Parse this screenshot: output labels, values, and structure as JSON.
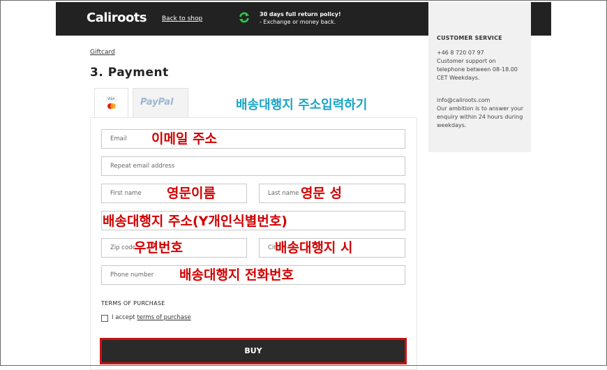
{
  "header": {
    "logo": "Caliroots",
    "back_link": "Back to shop",
    "policy_title": "30 days full return policy!",
    "policy_sub": "- Exchange or money back."
  },
  "breadcrumb": "Giftcard",
  "step_title": "3. Payment",
  "payment_tabs": {
    "paypal": "PayPal"
  },
  "overlay_top": "배송대행지 주소입력하기",
  "form": {
    "email_placeholder": "Email",
    "repeat_email_placeholder": "Repeat email address",
    "first_name_placeholder": "First name",
    "last_name_placeholder": "Last name",
    "zip_placeholder": "Zip code",
    "city_placeholder": "City",
    "phone_placeholder": "Phone number"
  },
  "annotations": {
    "email": "이메일 주소",
    "first_name": "영문이름",
    "last_name": "영문 성",
    "address": "배송대행지 주소(Y개인식별번호)",
    "zip": "우편번호",
    "city": "배송대행지 시",
    "phone": "배송대행지 전화번호"
  },
  "terms": {
    "title": "TERMS OF PURCHASE",
    "accept_prefix": "I accept ",
    "accept_link": "terms of purchase"
  },
  "buy_label": "BUY",
  "sidebar": {
    "title": "CUSTOMER SERVICE",
    "phone": "+46 8 720 07 97",
    "phone_desc": "Customer support on telephone between 08-18.00 CET Weekdays.",
    "email": "info@caliroots.com",
    "email_desc": "Our ambition is to answer your enquiry within 24 hours during weekdays."
  }
}
